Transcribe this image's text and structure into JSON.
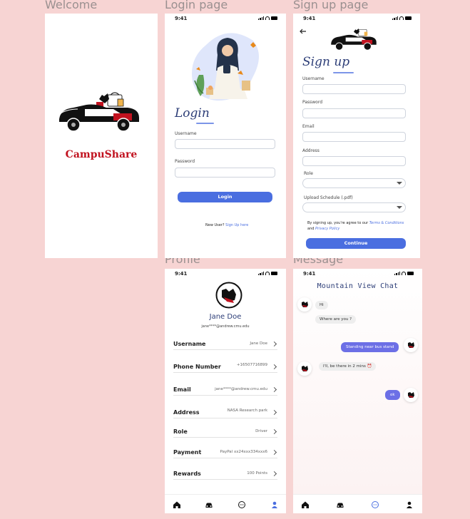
{
  "frames": {
    "welcome": "Welcome",
    "login": "Login page",
    "signup": "Sign up page",
    "profile": "Profile",
    "message": "Message"
  },
  "status_time": "9:41",
  "welcome": {
    "brand": "CampuShare"
  },
  "login": {
    "heading": "Login",
    "username_label": "Username",
    "password_label": "Password",
    "button": "Login",
    "new_user": "New User?",
    "signup_link": "Sign Up here"
  },
  "signup": {
    "heading": "Sign up",
    "username_label": "Username",
    "password_label": "Password",
    "email_label": "Email",
    "address_label": "Address",
    "role_label": "Role",
    "upload_label": "Upload Schedule (.pdf)",
    "agree_text": "By signing up, you're agree to our",
    "terms_link": "Terms & Conditions",
    "and_text": "and",
    "privacy_link": "Privacy Policy",
    "button": "Continue"
  },
  "profile": {
    "name": "Jane Doe",
    "email": "jane****@andrew.cmu.edu",
    "rows": [
      {
        "key": "Username",
        "value": "Jane Doe"
      },
      {
        "key": "Phone Number",
        "value": "+16507716899"
      },
      {
        "key": "Email",
        "value": "jane****@andrew.cmu.edu"
      },
      {
        "key": "Address",
        "value": "NASA Research park"
      },
      {
        "key": "Role",
        "value": "Driver"
      },
      {
        "key": "Payment",
        "value": "PayPal xx24xxx334xxx6"
      },
      {
        "key": "Rewards",
        "value": "100 Points"
      }
    ]
  },
  "chat": {
    "title": "Mountain View Chat",
    "messages": [
      {
        "text": "Hi"
      },
      {
        "text": "Where are you ?"
      },
      {
        "text": "Standing near bus stand"
      },
      {
        "text": "I'll, be there in 2 mins ⏰"
      },
      {
        "text": "ok"
      }
    ]
  },
  "colors": {
    "background": "#f7d4d3",
    "brand": "#c1121f",
    "primary": "#4a6ee0",
    "heading": "#2c3d77",
    "bubble_out": "#6c6fe6"
  }
}
